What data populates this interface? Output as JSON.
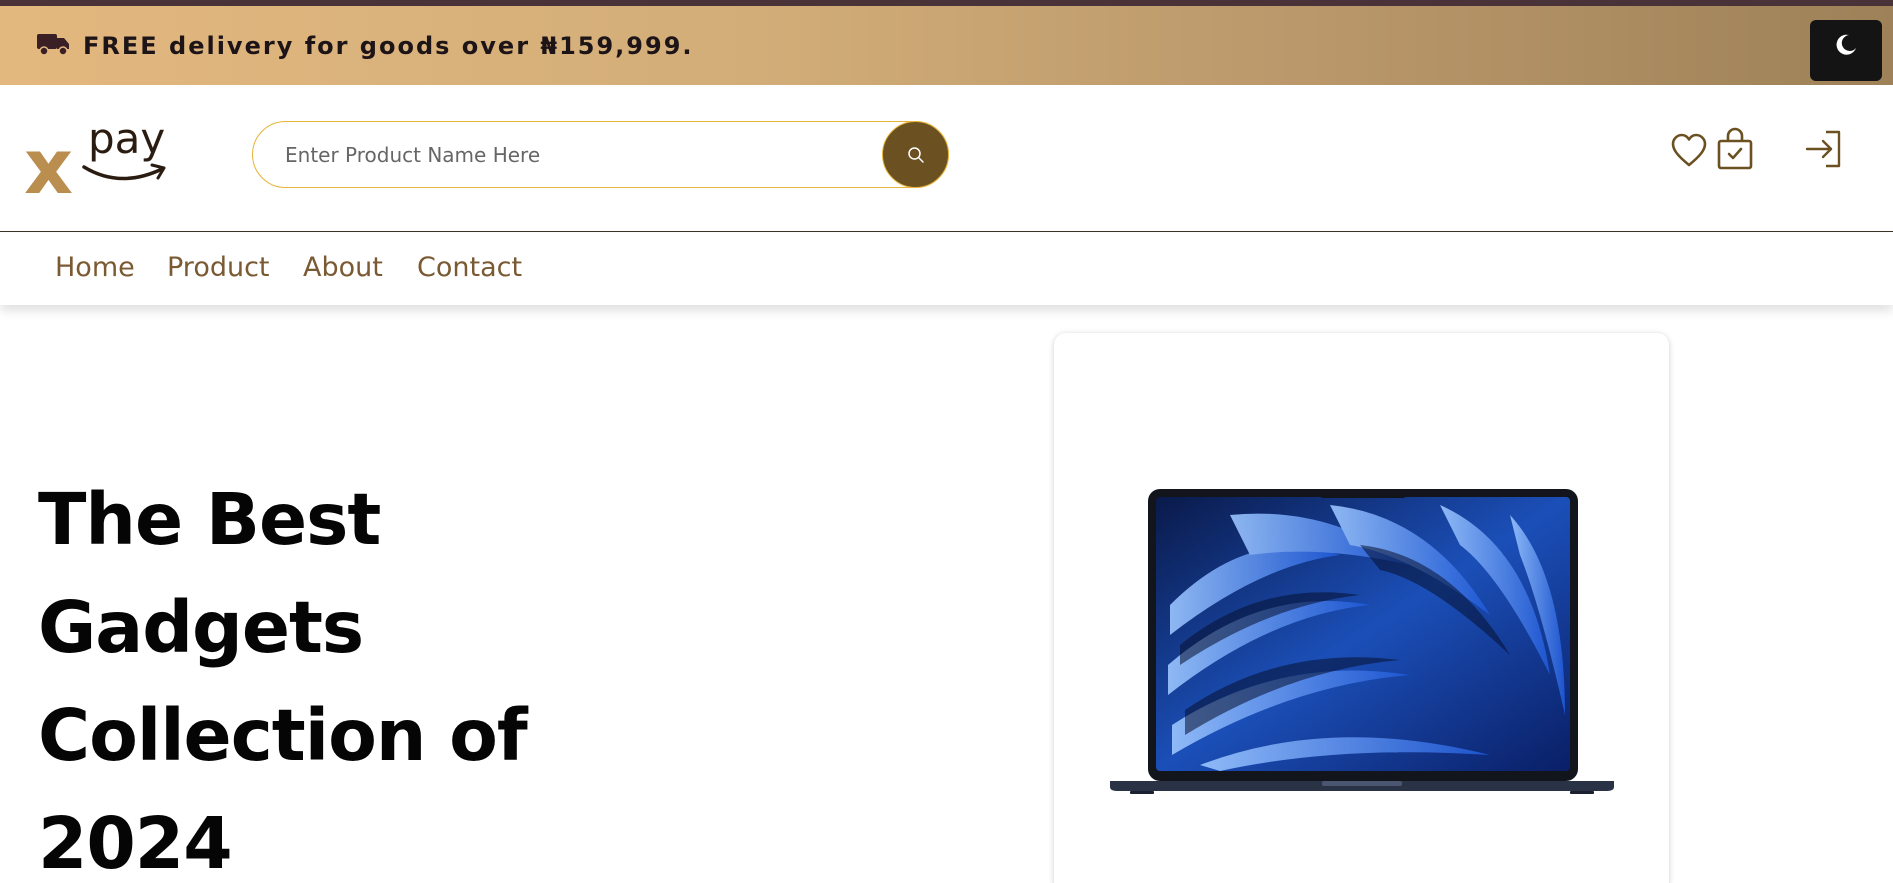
{
  "promo": {
    "text": "FREE delivery for goods over ₦159,999.",
    "icon": "truck-icon"
  },
  "theme_toggle": {
    "icon": "moon-icon"
  },
  "logo": {
    "x": "x",
    "pay": "pay"
  },
  "search": {
    "placeholder": "Enter Product Name Here",
    "value": "",
    "button_icon": "search-icon"
  },
  "header_icons": [
    "heart-icon",
    "shopping-bag-check-icon",
    "login-icon"
  ],
  "nav": {
    "items": [
      {
        "label": "Home"
      },
      {
        "label": "Product"
      },
      {
        "label": "About"
      },
      {
        "label": "Contact"
      }
    ]
  },
  "hero": {
    "lines": [
      "The Best",
      "Gadgets",
      "Collection of",
      "2024"
    ],
    "image": "laptop-image"
  },
  "colors": {
    "promo_gradient_start": "#e3b87f",
    "promo_gradient_end": "#9e8158",
    "accent_brown": "#6b5122",
    "nav_text": "#7a5a33",
    "search_border": "#e8b43a",
    "logo_gold": "#b98e4e"
  }
}
